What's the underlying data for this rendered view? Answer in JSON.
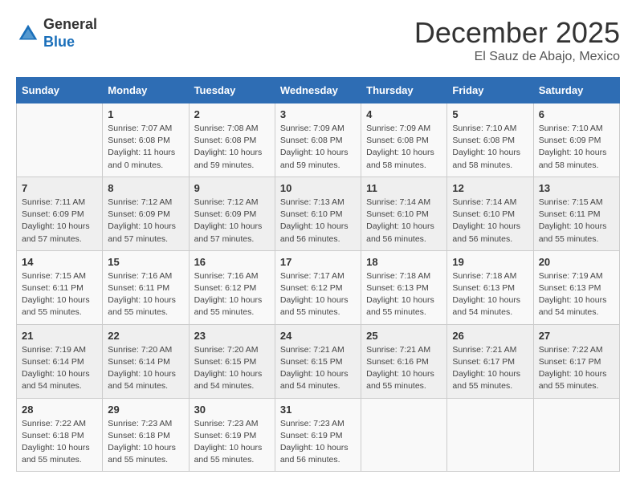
{
  "logo": {
    "general": "General",
    "blue": "Blue"
  },
  "title": "December 2025",
  "subtitle": "El Sauz de Abajo, Mexico",
  "days_of_week": [
    "Sunday",
    "Monday",
    "Tuesday",
    "Wednesday",
    "Thursday",
    "Friday",
    "Saturday"
  ],
  "weeks": [
    [
      {
        "day": "",
        "info": ""
      },
      {
        "day": "1",
        "info": "Sunrise: 7:07 AM\nSunset: 6:08 PM\nDaylight: 11 hours\nand 0 minutes."
      },
      {
        "day": "2",
        "info": "Sunrise: 7:08 AM\nSunset: 6:08 PM\nDaylight: 10 hours\nand 59 minutes."
      },
      {
        "day": "3",
        "info": "Sunrise: 7:09 AM\nSunset: 6:08 PM\nDaylight: 10 hours\nand 59 minutes."
      },
      {
        "day": "4",
        "info": "Sunrise: 7:09 AM\nSunset: 6:08 PM\nDaylight: 10 hours\nand 58 minutes."
      },
      {
        "day": "5",
        "info": "Sunrise: 7:10 AM\nSunset: 6:08 PM\nDaylight: 10 hours\nand 58 minutes."
      },
      {
        "day": "6",
        "info": "Sunrise: 7:10 AM\nSunset: 6:09 PM\nDaylight: 10 hours\nand 58 minutes."
      }
    ],
    [
      {
        "day": "7",
        "info": "Sunrise: 7:11 AM\nSunset: 6:09 PM\nDaylight: 10 hours\nand 57 minutes."
      },
      {
        "day": "8",
        "info": "Sunrise: 7:12 AM\nSunset: 6:09 PM\nDaylight: 10 hours\nand 57 minutes."
      },
      {
        "day": "9",
        "info": "Sunrise: 7:12 AM\nSunset: 6:09 PM\nDaylight: 10 hours\nand 57 minutes."
      },
      {
        "day": "10",
        "info": "Sunrise: 7:13 AM\nSunset: 6:10 PM\nDaylight: 10 hours\nand 56 minutes."
      },
      {
        "day": "11",
        "info": "Sunrise: 7:14 AM\nSunset: 6:10 PM\nDaylight: 10 hours\nand 56 minutes."
      },
      {
        "day": "12",
        "info": "Sunrise: 7:14 AM\nSunset: 6:10 PM\nDaylight: 10 hours\nand 56 minutes."
      },
      {
        "day": "13",
        "info": "Sunrise: 7:15 AM\nSunset: 6:11 PM\nDaylight: 10 hours\nand 55 minutes."
      }
    ],
    [
      {
        "day": "14",
        "info": "Sunrise: 7:15 AM\nSunset: 6:11 PM\nDaylight: 10 hours\nand 55 minutes."
      },
      {
        "day": "15",
        "info": "Sunrise: 7:16 AM\nSunset: 6:11 PM\nDaylight: 10 hours\nand 55 minutes."
      },
      {
        "day": "16",
        "info": "Sunrise: 7:16 AM\nSunset: 6:12 PM\nDaylight: 10 hours\nand 55 minutes."
      },
      {
        "day": "17",
        "info": "Sunrise: 7:17 AM\nSunset: 6:12 PM\nDaylight: 10 hours\nand 55 minutes."
      },
      {
        "day": "18",
        "info": "Sunrise: 7:18 AM\nSunset: 6:13 PM\nDaylight: 10 hours\nand 55 minutes."
      },
      {
        "day": "19",
        "info": "Sunrise: 7:18 AM\nSunset: 6:13 PM\nDaylight: 10 hours\nand 54 minutes."
      },
      {
        "day": "20",
        "info": "Sunrise: 7:19 AM\nSunset: 6:13 PM\nDaylight: 10 hours\nand 54 minutes."
      }
    ],
    [
      {
        "day": "21",
        "info": "Sunrise: 7:19 AM\nSunset: 6:14 PM\nDaylight: 10 hours\nand 54 minutes."
      },
      {
        "day": "22",
        "info": "Sunrise: 7:20 AM\nSunset: 6:14 PM\nDaylight: 10 hours\nand 54 minutes."
      },
      {
        "day": "23",
        "info": "Sunrise: 7:20 AM\nSunset: 6:15 PM\nDaylight: 10 hours\nand 54 minutes."
      },
      {
        "day": "24",
        "info": "Sunrise: 7:21 AM\nSunset: 6:15 PM\nDaylight: 10 hours\nand 54 minutes."
      },
      {
        "day": "25",
        "info": "Sunrise: 7:21 AM\nSunset: 6:16 PM\nDaylight: 10 hours\nand 55 minutes."
      },
      {
        "day": "26",
        "info": "Sunrise: 7:21 AM\nSunset: 6:17 PM\nDaylight: 10 hours\nand 55 minutes."
      },
      {
        "day": "27",
        "info": "Sunrise: 7:22 AM\nSunset: 6:17 PM\nDaylight: 10 hours\nand 55 minutes."
      }
    ],
    [
      {
        "day": "28",
        "info": "Sunrise: 7:22 AM\nSunset: 6:18 PM\nDaylight: 10 hours\nand 55 minutes."
      },
      {
        "day": "29",
        "info": "Sunrise: 7:23 AM\nSunset: 6:18 PM\nDaylight: 10 hours\nand 55 minutes."
      },
      {
        "day": "30",
        "info": "Sunrise: 7:23 AM\nSunset: 6:19 PM\nDaylight: 10 hours\nand 55 minutes."
      },
      {
        "day": "31",
        "info": "Sunrise: 7:23 AM\nSunset: 6:19 PM\nDaylight: 10 hours\nand 56 minutes."
      },
      {
        "day": "",
        "info": ""
      },
      {
        "day": "",
        "info": ""
      },
      {
        "day": "",
        "info": ""
      }
    ]
  ]
}
